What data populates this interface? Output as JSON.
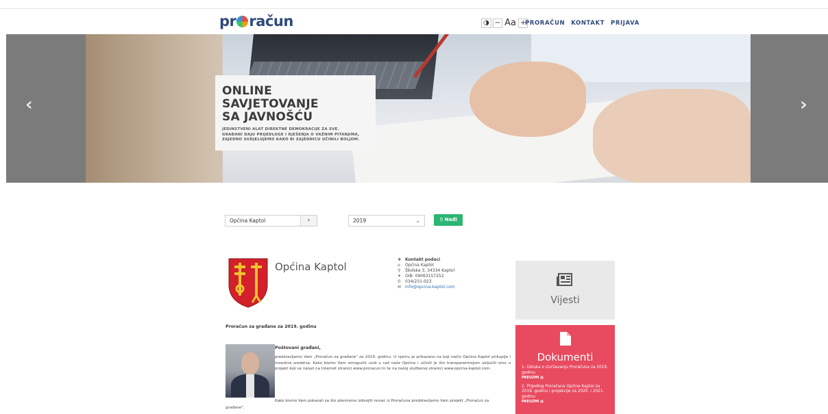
{
  "header": {
    "logo_prefix": "pr",
    "logo_suffix": "račun",
    "tools": {
      "contrast": "◑",
      "decrease": "−",
      "font": "Aa",
      "increase": "+"
    },
    "nav": [
      "PRORAČUN",
      "KONTAKT",
      "PRIJAVA"
    ]
  },
  "hero": {
    "title_line1": "ONLINE SAVJETOVANJE",
    "title_line2": "SA JAVNOŠĆU",
    "subtitle_line1": "JEDINSTVENI ALAT DIREKTNE DEMOKRACIJE ZA SVE.",
    "subtitle_line2": "GRAĐANI DAJU PRIJEDLOGE I RJEŠENJA O VAŽNIM PITANJIMA,",
    "subtitle_line3": "ZAJEDNO SUDJELUJEMO KAKO BI ZAJEDNICU UČINILI BOLJOM.",
    "prev_icon": "chevron-left-icon",
    "next_icon": "chevron-right-icon"
  },
  "filters": {
    "municipality": "Općina Kaptol",
    "year": "2019",
    "search_button": "Nađi"
  },
  "municipality": {
    "name": "Općina Kaptol",
    "contact_title": "Kontakt podaci",
    "contact_name": "Općina Kaptol",
    "address": "Školska 3, 34334 Kaptol",
    "oib": "OIB: 09063157252",
    "phone": "034/231-023",
    "email": "info@opcina-kaptol.com"
  },
  "content": {
    "heading": "Proračun za građane za 2019. godinu",
    "greeting": "Poštovani građani,",
    "paragraph1": "predstavljamo Vam „Proračun za građane\" za 2019. godinu. U njemu je prikazano na koji način Općina Kaptol prikuplja i investira sredstva. Kako bismo Vam omogućili uvid u rad naše Općine i učinili je što transparentnijom uključili smo u projekt koji se nalazi na Internet stranici www.proracun.hr te na našoj službenoj stranici www.opcina-kaptol.com.",
    "paragraph2_a": "Kako bismo Vam pokazali za što planiramo izdvojiti novac iz Proračuna predstavljamo Vam projekt „Proračun za",
    "paragraph2_b": "građane\"."
  },
  "sidebar": {
    "news_label": "Vijesti",
    "documents_label": "Dokumenti",
    "documents": [
      {
        "title": "1. Odluka o izvršavanju Proračuna za 2019. godinu",
        "action": "PREUZMI"
      },
      {
        "title": "2. Prijedlog Proračuna Općine Kaptol za 2019. godinu i projekcije za 2020. i 2021. godinu",
        "action": "PREUZMI"
      }
    ]
  },
  "colors": {
    "brand": "#2f4a7a",
    "search_button": "#2bb673",
    "documents_card": "#e84a5f",
    "news_card": "#e9e9e9",
    "slider_bg": "#7b7b7b"
  }
}
